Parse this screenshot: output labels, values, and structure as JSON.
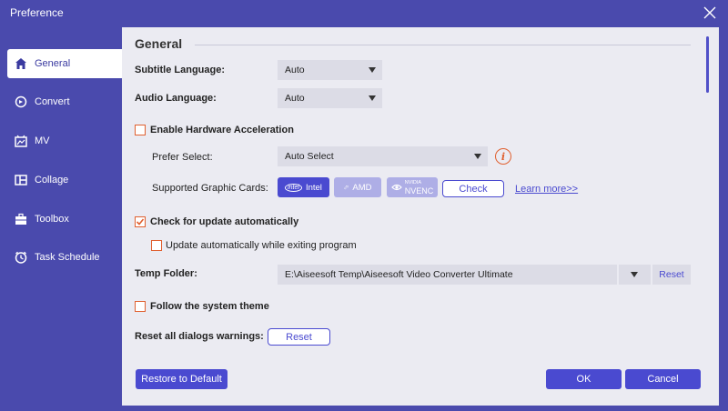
{
  "window": {
    "title": "Preference",
    "close_icon": "close-icon"
  },
  "sidebar": {
    "items": [
      {
        "label": "General",
        "icon": "home-icon",
        "active": true
      },
      {
        "label": "Convert",
        "icon": "convert-icon",
        "active": false
      },
      {
        "label": "MV",
        "icon": "mv-icon",
        "active": false
      },
      {
        "label": "Collage",
        "icon": "collage-icon",
        "active": false
      },
      {
        "label": "Toolbox",
        "icon": "toolbox-icon",
        "active": false
      },
      {
        "label": "Task Schedule",
        "icon": "clock-icon",
        "active": false
      }
    ]
  },
  "general": {
    "section_title": "General",
    "subtitle_language": {
      "label": "Subtitle Language:",
      "value": "Auto"
    },
    "audio_language": {
      "label": "Audio Language:",
      "value": "Auto"
    },
    "hardware_acceleration": {
      "label": "Enable Hardware Acceleration",
      "checked": false
    },
    "prefer_select": {
      "label": "Prefer Select:",
      "value": "Auto Select",
      "info_icon": "i"
    },
    "graphic_cards": {
      "label": "Supported Graphic Cards:",
      "cards": [
        {
          "label": "Intel",
          "badge": "intel",
          "enabled": true
        },
        {
          "label": "AMD",
          "badge": "⬀",
          "enabled": false
        },
        {
          "label": "NVENC",
          "badge": "NVIDIA",
          "enabled": false
        }
      ],
      "check_label": "Check",
      "learn_more": "Learn more>>"
    },
    "check_update": {
      "label": "Check for update automatically",
      "checked": true
    },
    "update_on_exit": {
      "label": "Update automatically while exiting program",
      "checked": false
    },
    "temp_folder": {
      "label": "Temp Folder:",
      "value": "E:\\Aiseesoft Temp\\Aiseesoft Video Converter Ultimate",
      "reset_label": "Reset"
    },
    "follow_theme": {
      "label": "Follow the system theme",
      "checked": false
    },
    "reset_dialogs": {
      "label": "Reset all dialogs warnings:",
      "button": "Reset"
    }
  },
  "footer": {
    "restore_label": "Restore to Default",
    "ok_label": "OK",
    "cancel_label": "Cancel"
  },
  "colors": {
    "accent": "#4a4ad0",
    "checkbox": "#e06030",
    "sidebar": "#4a4aad"
  }
}
